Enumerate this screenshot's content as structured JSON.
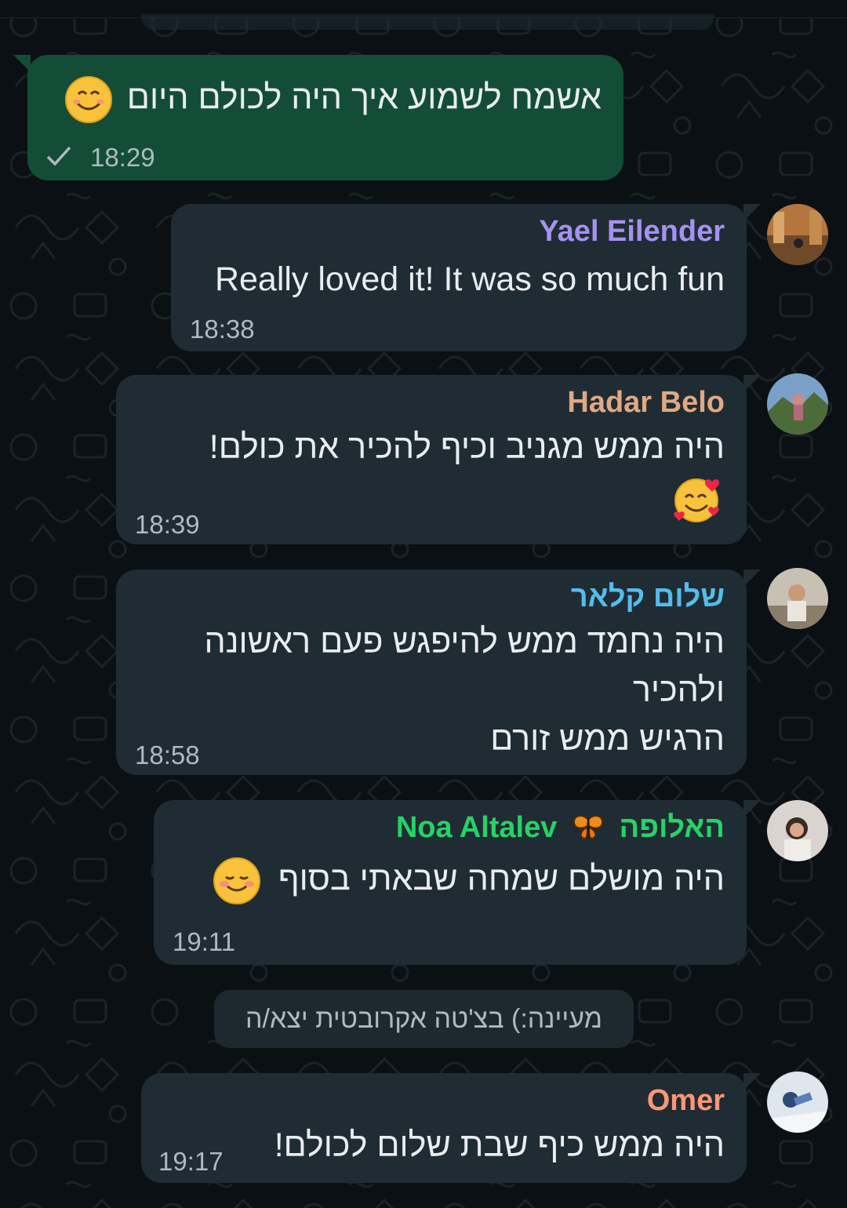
{
  "outgoing": {
    "text": "אשמח לשמוע איך היה לכולם היום",
    "emoji": "smiling-face-icon",
    "time": "18:29",
    "status": "sent-check-icon"
  },
  "messages": [
    {
      "sender": "Yael Eilender",
      "sender_color": "#a791f2",
      "text": "Really loved it! It was so much fun",
      "time": "18:38"
    },
    {
      "sender": "Hadar Belo",
      "sender_color": "#dfa984",
      "text": "היה ממש מגניב וכיף להכיר את כולם!",
      "emoji": "smiling-face-with-hearts-icon",
      "time": "18:39"
    },
    {
      "sender": "שלום קלאר",
      "sender_color": "#53bdeb",
      "lines": [
        "היה נחמד ממש להיפגש פעם ראשונה",
        "ולהכיר",
        "הרגיש ממש זורם"
      ],
      "time": "18:58"
    },
    {
      "sender_name": "Noa Altalev",
      "sender_suffix": "האלופה",
      "sender_emoji": "butterfly-icon",
      "sender_color": "#25d366",
      "text": "היה מושלם שמחה שבאתי בסוף",
      "emoji": "blushing-smile-icon",
      "time": "19:11"
    },
    {
      "sender": "Omer",
      "sender_color": "#fc9775",
      "text": "היה ממש כיף שבת שלום לכולם!",
      "time": "19:17"
    }
  ],
  "system_message": "מעיינה:) בצ'טה אקרובטית יצא/ה"
}
